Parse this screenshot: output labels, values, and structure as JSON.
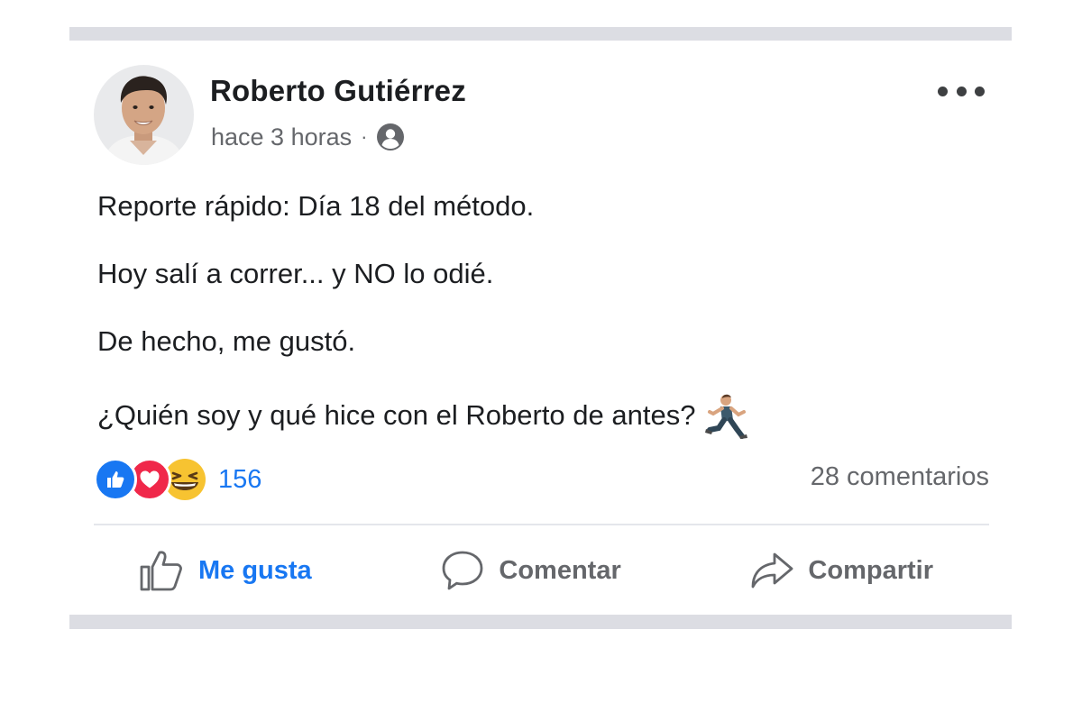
{
  "post": {
    "author": "Roberto Gutiérrez",
    "time": "hace 3 horas",
    "separator": "·",
    "audience_icon": "friends-icon",
    "lines": [
      "Reporte rápido: Día 18 del método.",
      "Hoy salí a correr... y NO lo odié.",
      "De hecho, me gustó.",
      "¿Quién soy y qué hice con el Roberto de antes?"
    ],
    "emoji": "runner-icon"
  },
  "reactions": {
    "icons": [
      "like-icon",
      "love-icon",
      "haha-icon"
    ],
    "count": "156",
    "comments": "28 comentarios"
  },
  "actions": {
    "like": "Me gusta",
    "comment": "Comentar",
    "share": "Compartir"
  },
  "colors": {
    "accent": "#1877f2",
    "love": "#f0284a",
    "muted": "#65676b",
    "separator_bars": "#dcdde3"
  }
}
